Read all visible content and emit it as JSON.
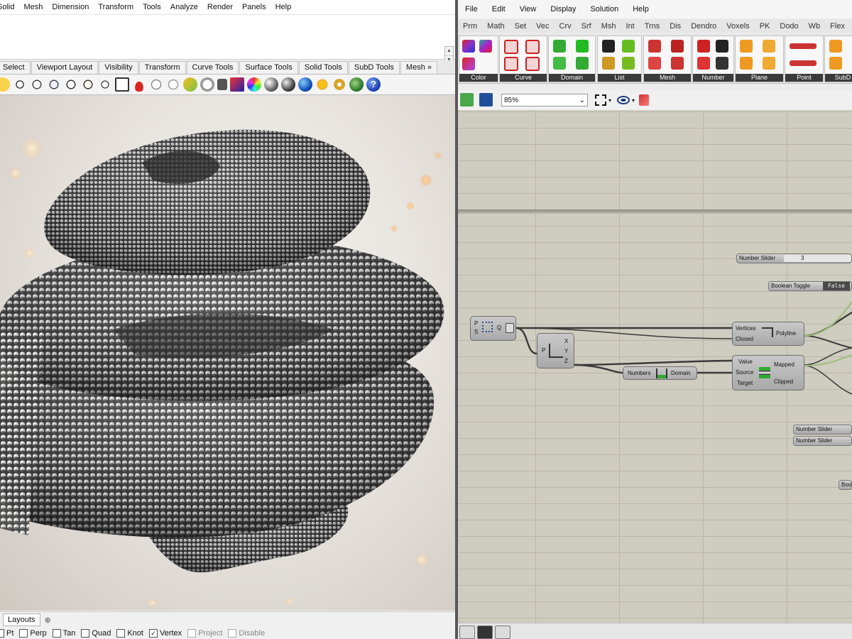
{
  "rhino": {
    "menu": [
      "Solid",
      "Mesh",
      "Dimension",
      "Transform",
      "Tools",
      "Analyze",
      "Render",
      "Panels",
      "Help"
    ],
    "tabs": [
      "Select",
      "Viewport Layout",
      "Visibility",
      "Transform",
      "Curve Tools",
      "Surface Tools",
      "Solid Tools",
      "SubD Tools",
      "Mesh »"
    ],
    "bottom_tab": "Layouts",
    "add_tab_symbol": "⊕",
    "osnaps": [
      {
        "label": "Pt",
        "checked": false
      },
      {
        "label": "Perp",
        "checked": false
      },
      {
        "label": "Tan",
        "checked": false
      },
      {
        "label": "Quad",
        "checked": false
      },
      {
        "label": "Knot",
        "checked": false
      },
      {
        "label": "Vertex",
        "checked": true
      },
      {
        "label": "Project",
        "checked": false,
        "dim": true
      },
      {
        "label": "Disable",
        "checked": false,
        "dim": true
      }
    ]
  },
  "grasshopper": {
    "menu": [
      "File",
      "Edit",
      "View",
      "Display",
      "Solution",
      "Help"
    ],
    "tabs": [
      "Prm",
      "Math",
      "Set",
      "Vec",
      "Crv",
      "Srf",
      "Msh",
      "Int",
      "Trns",
      "Dis",
      "Dendro",
      "Voxels",
      "PK",
      "Dodo",
      "Wb",
      "Flex"
    ],
    "ribbon_groups": [
      "Color",
      "Curve",
      "Domain",
      "List",
      "Mesh",
      "Number",
      "Plane",
      "Point",
      "SubD"
    ],
    "zoom": "85%",
    "canvas": {
      "number_slider": "Number Slider",
      "slider_value": "3",
      "boolean_toggle": "Boolean Toggle",
      "toggle_value": "False",
      "polyline": {
        "in1": "Vertices",
        "in2": "Closed",
        "name": "Polyline"
      },
      "remap": {
        "in1": "Value",
        "in2": "Source",
        "in3": "Target",
        "out1": "Mapped",
        "out2": "Clipped"
      },
      "bounds": {
        "in": "Numbers",
        "out": "Domain"
      },
      "deconstruct": {
        "in": "P",
        "out1": "X",
        "out2": "Y",
        "out3": "Z"
      },
      "pop": {
        "in1": "P",
        "in2": "S",
        "out": "Q"
      },
      "slider_b": "Number Slider",
      "slider_c": "Number Slider",
      "boo_cut": "Boo"
    }
  },
  "colors": {
    "canvas": "#cfccc0",
    "component": "#b5b5b5",
    "wire_green": "#9fbe7a"
  }
}
